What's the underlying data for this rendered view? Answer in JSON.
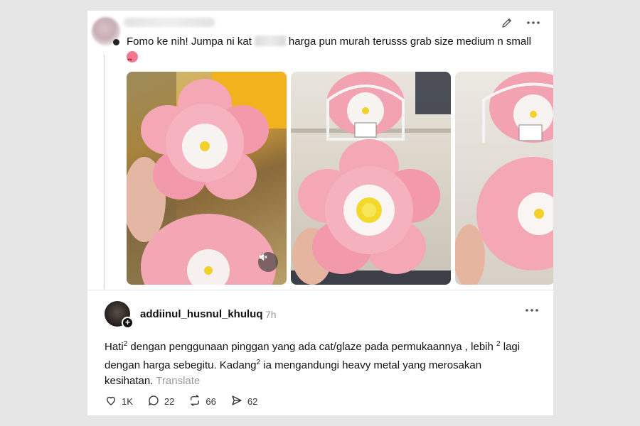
{
  "post": {
    "text_part1": "Fomo ke nih! Jumpa ni kat",
    "text_part2": "harga pun murah terusss grab size medium n small",
    "icons": [
      "edit-icon",
      "more-icon",
      "mute-icon",
      "smiling-face-with-heart-eyes-icon"
    ]
  },
  "reply": {
    "username": "addiinul_husnul_khuluq",
    "time": "7h",
    "text_a": "Hati",
    "sup1": "2",
    "text_b": " dengan penggunaan pinggan yang ada cat/glaze pada permukaannya , lebih ",
    "sup2": "2",
    "text_c": " lagi dengan harga sebegitu. Kadang",
    "sup3": "2",
    "text_d": " ia mengandungi heavy metal yang merosakan kesihatan.",
    "translate_label": "Translate",
    "actions": {
      "like_count": "1K",
      "comment_count": "22",
      "repost_count": "66",
      "share_count": "62"
    }
  }
}
